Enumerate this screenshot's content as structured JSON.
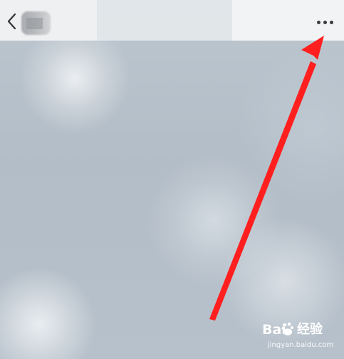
{
  "screen": {
    "background_color": "#b4bec8"
  },
  "header": {
    "back_icon": "chevron-left-icon",
    "avatar": "blurred-avatar",
    "more_icon": "more-horizontal-icon",
    "more_dots_color": "#3a3a3a"
  },
  "annotation": {
    "arrow_color": "#ff1f1f",
    "arrow_icon": "red-arrow-pointing-to-more-button"
  },
  "watermark": {
    "brand_prefix": "Bai",
    "brand_suffix": "经验",
    "url": "jingyan.baidu.com",
    "paw_icon": "paw-icon"
  }
}
